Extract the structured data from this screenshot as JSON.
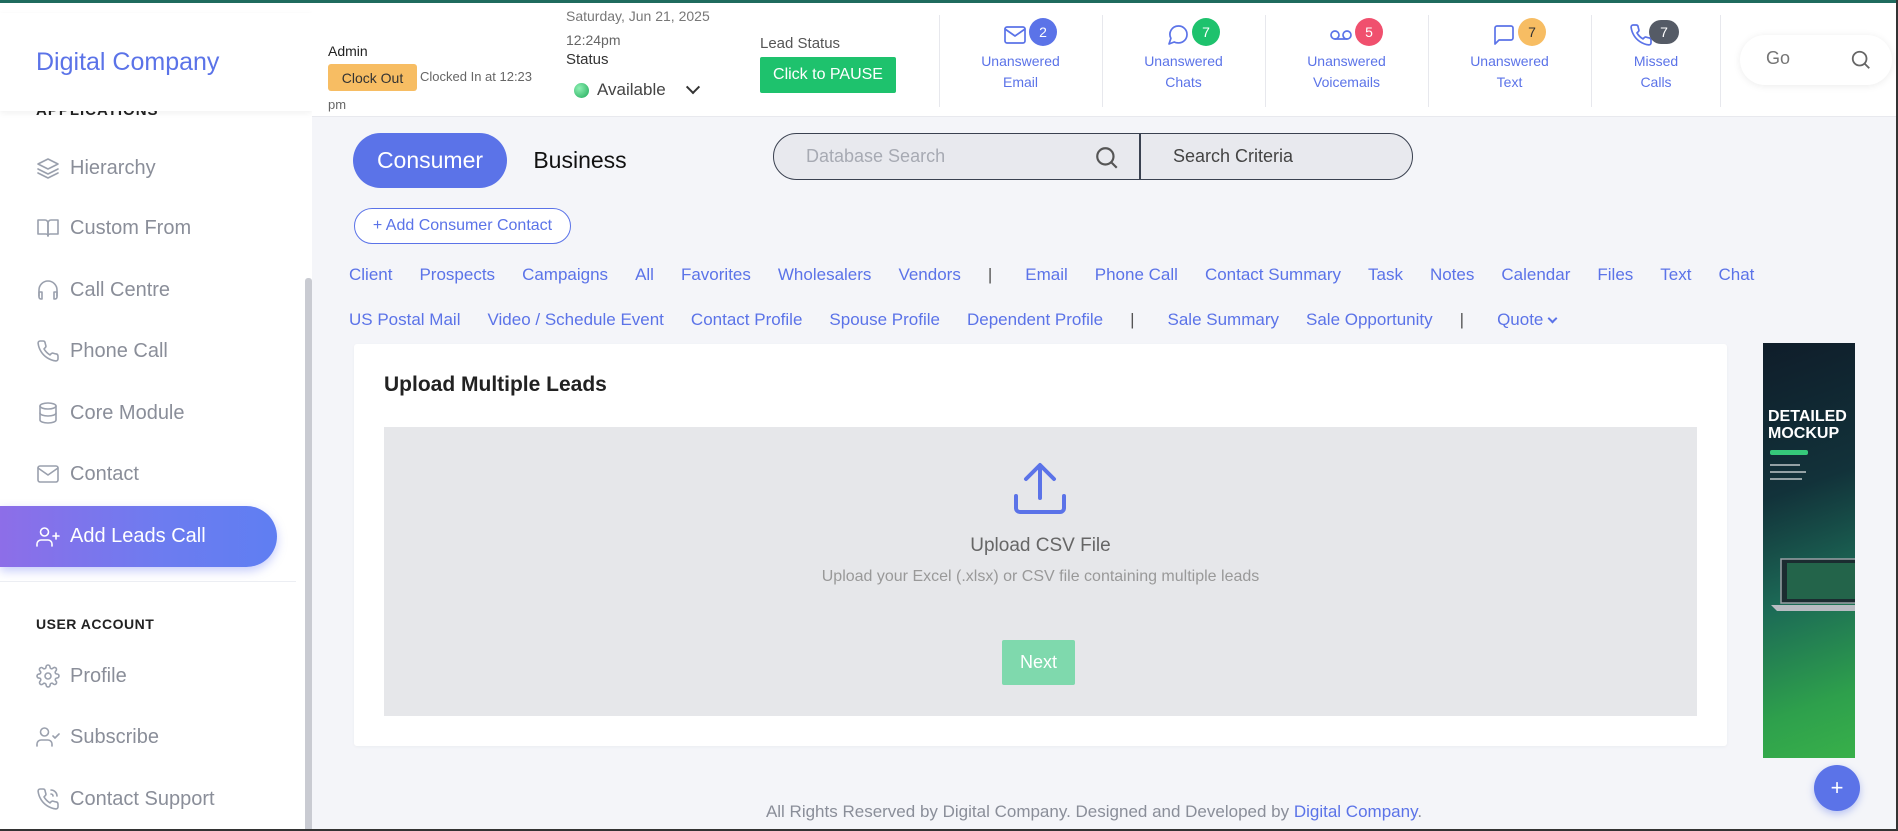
{
  "brand": "Digital Company",
  "sidebar": {
    "cut_heading": "APPLICATIONS",
    "items": [
      {
        "label": "Hierarchy",
        "icon": "layers-icon"
      },
      {
        "label": "Custom From",
        "icon": "book-icon"
      },
      {
        "label": "Call Centre",
        "icon": "headphones-icon"
      },
      {
        "label": "Phone Call",
        "icon": "phone-icon"
      },
      {
        "label": "Core Module",
        "icon": "database-icon"
      },
      {
        "label": "Contact",
        "icon": "mail-icon"
      },
      {
        "label": "Add Leads Call",
        "icon": "user-plus-icon",
        "active": true
      }
    ],
    "account_heading": "USER ACCOUNT",
    "account_items": [
      {
        "label": "Profile",
        "icon": "gear-icon"
      },
      {
        "label": "Subscribe",
        "icon": "user-check-icon"
      },
      {
        "label": "Contact Support",
        "icon": "phone-support-icon"
      }
    ]
  },
  "header": {
    "role": "Admin",
    "clock_out": "Clock Out",
    "clocked_in": "Clocked In at 12:23",
    "clocked_in_pm": "pm",
    "date": "Saturday, Jun 21, 2025",
    "time": "12:24pm",
    "status_label": "Status",
    "status_value": "Available",
    "lead_status_label": "Lead Status",
    "pause_button": "Click to PAUSE",
    "notifications": [
      {
        "line1": "Unanswered",
        "line2": "Email",
        "count": "2",
        "color": "#5b73e8",
        "icon": "mail-icon"
      },
      {
        "line1": "Unanswered",
        "line2": "Chats",
        "count": "7",
        "color": "#1ec26d",
        "icon": "chat-icon"
      },
      {
        "line1": "Unanswered",
        "line2": "Voicemails",
        "count": "5",
        "color": "#f0506e",
        "icon": "voicemail-icon"
      },
      {
        "line1": "Unanswered",
        "line2": "Text",
        "count": "7",
        "color": "#f7bd63",
        "icon": "message-icon"
      },
      {
        "line1": "Missed",
        "line2": "Calls",
        "count": "7",
        "color": "#555b66",
        "icon": "phone-icon"
      }
    ],
    "search_placeholder": "Go"
  },
  "main": {
    "tab_consumer": "Consumer",
    "tab_business": "Business",
    "db_search_placeholder": "Database Search",
    "search_criteria": "Search Criteria",
    "add_contact": "+ Add Consumer Contact",
    "nav_row1": [
      "Client",
      "Prospects",
      "Campaigns",
      "All",
      "Favorites",
      "Wholesalers",
      "Vendors",
      "|",
      "Email",
      "Phone Call",
      "Contact Summary",
      "Task",
      "Notes",
      "Calendar",
      "Files",
      "Text",
      "Chat"
    ],
    "nav_row2": [
      "US Postal Mail",
      "Video / Schedule Event",
      "Contact Profile",
      "Spouse Profile",
      "Dependent Profile",
      "|",
      "Sale Summary",
      "Sale Opportunity",
      "|",
      "Quote"
    ]
  },
  "upload": {
    "title": "Upload Multiple Leads",
    "dz_title": "Upload CSV File",
    "dz_sub": "Upload your Excel (.xlsx) or CSV file containing multiple leads",
    "next": "Next"
  },
  "ad": {
    "headline_1": "DETAILED",
    "headline_2": "MOCKUP"
  },
  "footer": {
    "text": "All Rights Reserved by Digital Company. Designed and Developed by ",
    "link": "Digital Company",
    "end": "."
  },
  "fab": "+"
}
